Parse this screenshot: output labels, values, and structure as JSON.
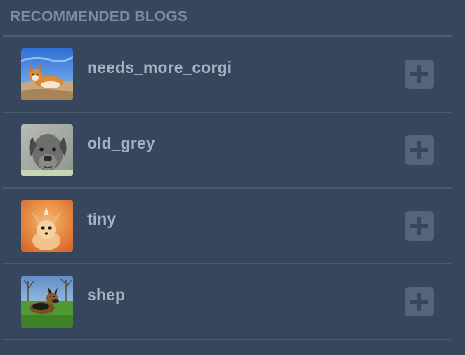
{
  "header": {
    "title": "RECOMMENDED BLOGS"
  },
  "blogs": [
    {
      "name": "needs_more_corgi",
      "avatar_icon": "corgi-avatar",
      "action_icon": "plus-icon"
    },
    {
      "name": "old_grey",
      "avatar_icon": "grey-dog-avatar",
      "action_icon": "plus-icon"
    },
    {
      "name": "tiny",
      "avatar_icon": "chihuahua-avatar",
      "action_icon": "plus-icon"
    },
    {
      "name": "shep",
      "avatar_icon": "shepherd-avatar",
      "action_icon": "plus-icon"
    }
  ],
  "colors": {
    "background": "#36465d",
    "header_text": "#7e8b9e",
    "name_text": "#a5b0c0",
    "button": "#56647a"
  }
}
